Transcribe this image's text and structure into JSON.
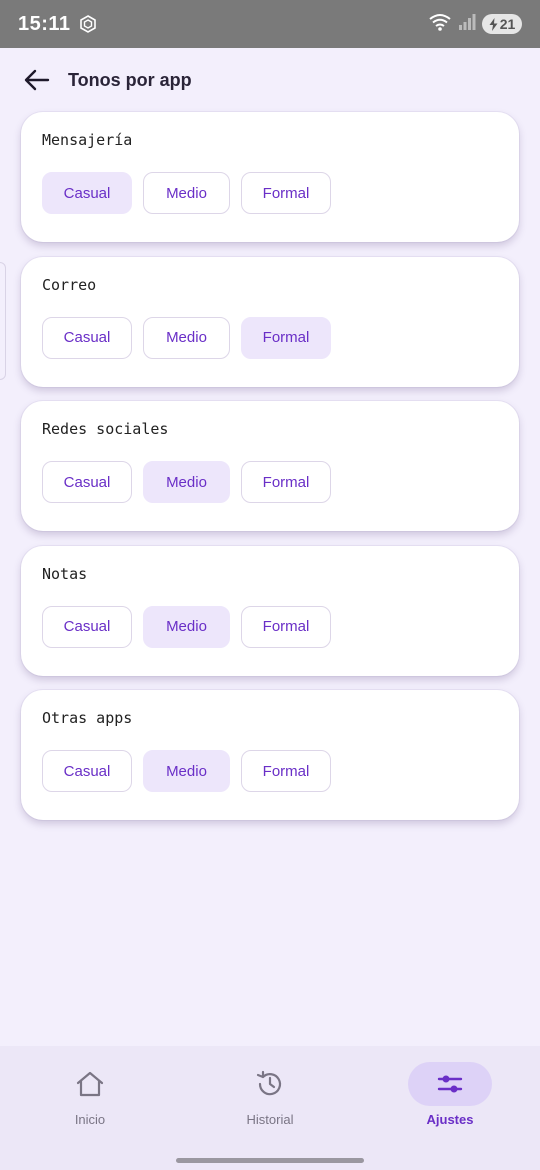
{
  "status_bar": {
    "time": "15:11",
    "battery": "21"
  },
  "header": {
    "title": "Tonos por app"
  },
  "tone_options": [
    "Casual",
    "Medio",
    "Formal"
  ],
  "apps": [
    {
      "name": "Mensajería",
      "selected": "Casual"
    },
    {
      "name": "Correo",
      "selected": "Formal"
    },
    {
      "name": "Redes sociales",
      "selected": "Medio"
    },
    {
      "name": "Notas",
      "selected": "Medio"
    },
    {
      "name": "Otras apps",
      "selected": "Medio"
    }
  ],
  "bottom_nav": {
    "items": [
      {
        "label": "Inicio",
        "icon": "home-icon",
        "active": false
      },
      {
        "label": "Historial",
        "icon": "history-icon",
        "active": false
      },
      {
        "label": "Ajustes",
        "icon": "sliders-icon",
        "active": true
      }
    ]
  },
  "colors": {
    "accent": "#6a2fc7",
    "selected_bg": "#ede6fb",
    "page_bg": "#f3effc",
    "status_bar": "#7a7a7a"
  }
}
